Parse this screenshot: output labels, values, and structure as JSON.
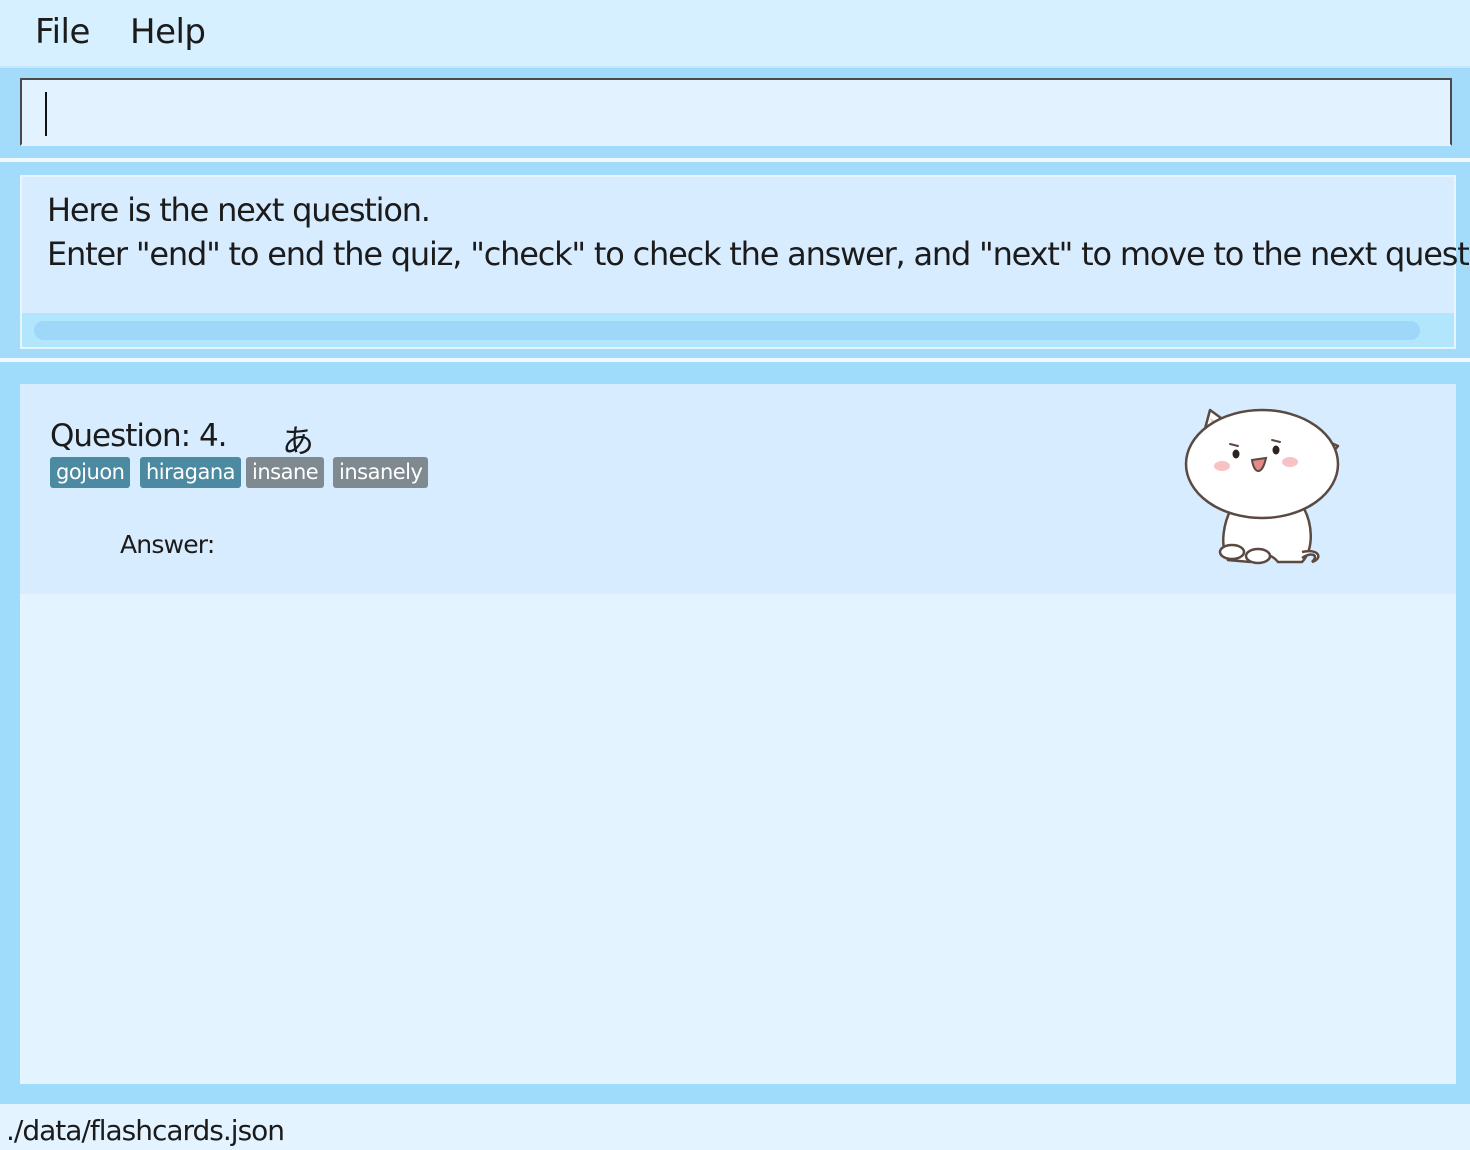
{
  "menubar": {
    "items": [
      "File",
      "Help"
    ]
  },
  "command_box": {
    "value": ""
  },
  "result_display": {
    "lines": [
      "Here is the next question.",
      "Enter \"end\" to end the quiz, \"check\" to check the answer, and \"next\" to move to the next question."
    ]
  },
  "flashcard": {
    "question_label": "Question: 4.",
    "question_text": "あ",
    "tags": [
      {
        "label": "gojuon",
        "color": "#4b8aa0"
      },
      {
        "label": "hiragana",
        "color": "#4b8aa0"
      },
      {
        "label": "insane",
        "color": "#7e8a90"
      },
      {
        "label": "insanely",
        "color": "#7e8a90"
      }
    ],
    "answer_label": "Answer:",
    "mascot_icon": "cat-mascot-icon"
  },
  "status_bar": {
    "file_path": "./data/flashcards.json"
  },
  "colors": {
    "background": "#9fdcfb",
    "menubar": "#d6f0ff",
    "panel": "#e3f3ff",
    "card": "#d8ecff"
  }
}
